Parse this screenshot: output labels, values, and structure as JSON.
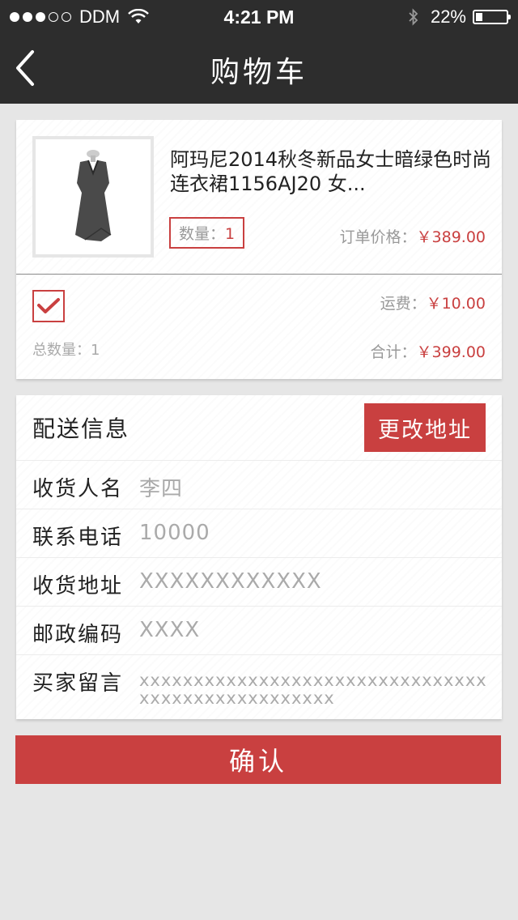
{
  "status_bar": {
    "carrier": "DDM",
    "time": "4:21 PM",
    "battery_percent": "22%",
    "battery_level": 0.22,
    "signal_bars_filled": 3,
    "signal_bars_total": 5
  },
  "nav": {
    "title": "购物车",
    "back_icon": "chevron-left-icon"
  },
  "order": {
    "product_title": "阿玛尼2014秋冬新品女士暗绿色时尚连衣裙1156AJ20 女...",
    "qty_label": "数量：",
    "qty_value": "1",
    "price_label": "订单价格：",
    "price_value": "￥389.00",
    "shipping_label": "运费：",
    "shipping_value": "￥10.00",
    "total_qty_label": "总数量：",
    "total_qty_value": "1",
    "sum_label": "合计：",
    "sum_value": "￥399.00",
    "selected": true
  },
  "delivery": {
    "title": "配送信息",
    "change_button": "更改地址",
    "fields": [
      {
        "label": "收货人名",
        "value": "李四"
      },
      {
        "label": "联系电话",
        "value": "10000"
      },
      {
        "label": "收货地址",
        "value": "XXXXXXXXXXXX"
      },
      {
        "label": "邮政编码",
        "value": "XXXX"
      },
      {
        "label": "买家留言",
        "value": "xxxxxxxxxxxxxxxxxxxxxxxxxxxxxxxxxxxxxxxxxxxxxxxxxx"
      }
    ]
  },
  "confirm_button": "确认",
  "colors": {
    "accent": "#c94040",
    "header_bg": "#2d2d2d",
    "page_bg": "#e6e6e6"
  }
}
